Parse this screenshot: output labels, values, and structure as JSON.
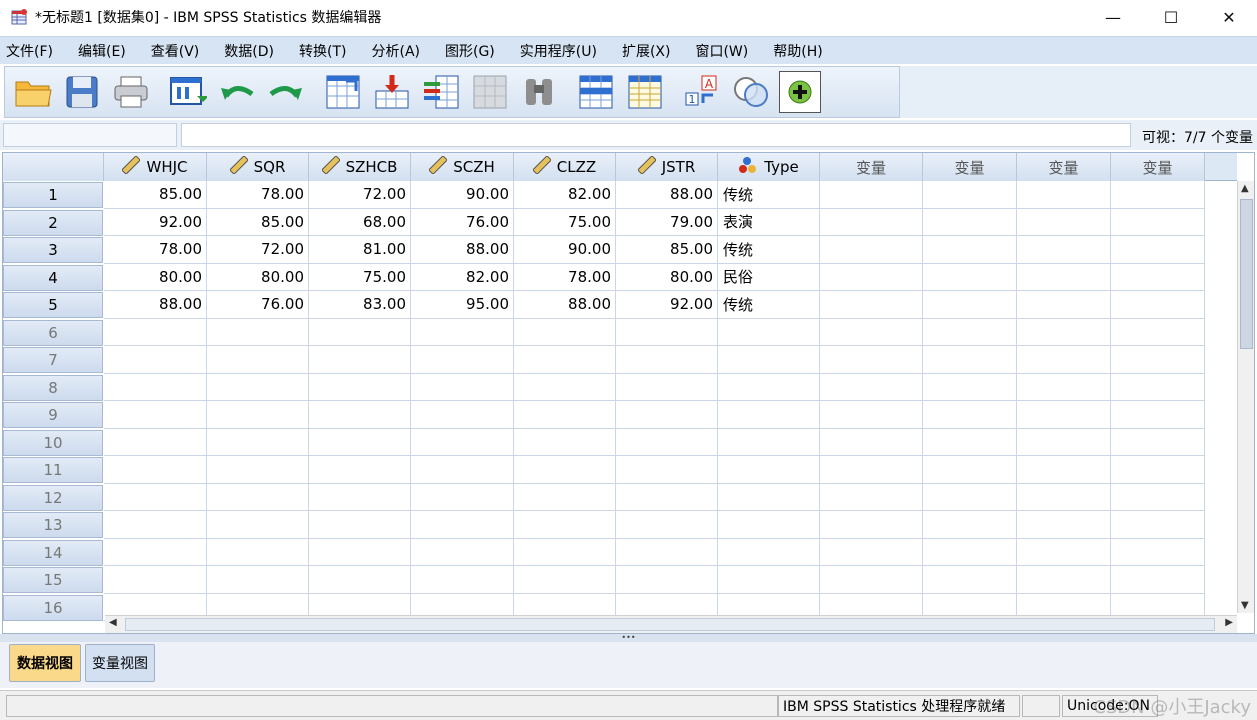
{
  "window": {
    "title": "*无标题1 [数据集0] - IBM SPSS Statistics 数据编辑器",
    "minimize": "—",
    "maximize": "☐",
    "close": "✕"
  },
  "menu": [
    "文件(F)",
    "编辑(E)",
    "查看(V)",
    "数据(D)",
    "转换(T)",
    "分析(A)",
    "图形(G)",
    "实用程序(U)",
    "扩展(X)",
    "窗口(W)",
    "帮助(H)"
  ],
  "toolbar": {
    "icons": [
      "open-folder-icon",
      "save-icon",
      "print-icon",
      "recall-dialog-icon",
      "undo-icon",
      "redo-icon",
      "goto-case-icon",
      "goto-variable-icon",
      "variables-icon",
      "run-descriptive-icon",
      "find-icon",
      "insert-cases-icon",
      "insert-variable-icon",
      "split-file-icon",
      "weight-cases-icon",
      "select-cases-icon",
      "value-labels-icon"
    ]
  },
  "editor": {
    "cell_ref": "",
    "cell_value": "",
    "visible_label": "可视：7/7 个变量"
  },
  "grid": {
    "columns": [
      {
        "name": "WHJC",
        "type": "scale"
      },
      {
        "name": "SQR",
        "type": "scale"
      },
      {
        "name": "SZHCB",
        "type": "scale"
      },
      {
        "name": "SCZH",
        "type": "scale"
      },
      {
        "name": "CLZZ",
        "type": "scale"
      },
      {
        "name": "JSTR",
        "type": "scale"
      },
      {
        "name": "Type",
        "type": "nominal"
      },
      {
        "name": "变量",
        "type": "empty"
      },
      {
        "name": "变量",
        "type": "empty"
      },
      {
        "name": "变量",
        "type": "empty"
      },
      {
        "name": "变量",
        "type": "empty"
      }
    ],
    "row_numbers": [
      "1",
      "2",
      "3",
      "4",
      "5",
      "6",
      "7",
      "8",
      "9",
      "10",
      "11",
      "12",
      "13",
      "14",
      "15",
      "16"
    ],
    "rows": [
      [
        "85.00",
        "78.00",
        "72.00",
        "90.00",
        "82.00",
        "88.00",
        "传统"
      ],
      [
        "92.00",
        "85.00",
        "68.00",
        "76.00",
        "75.00",
        "79.00",
        "表演"
      ],
      [
        "78.00",
        "72.00",
        "81.00",
        "88.00",
        "90.00",
        "85.00",
        "传统"
      ],
      [
        "80.00",
        "80.00",
        "75.00",
        "82.00",
        "78.00",
        "80.00",
        "民俗"
      ],
      [
        "88.00",
        "76.00",
        "83.00",
        "95.00",
        "88.00",
        "92.00",
        "传统"
      ]
    ]
  },
  "tabs": {
    "data_view": "数据视图",
    "variable_view": "变量视图"
  },
  "status": {
    "processor": "IBM SPSS Statistics 处理程序就绪",
    "unicode": "Unicode:ON",
    "watermark": "CSDN @小王Jacky"
  },
  "colors": {
    "menubar": "#d7e4f4",
    "active_tab": "#fbd98a",
    "header": "#dde8f5"
  }
}
